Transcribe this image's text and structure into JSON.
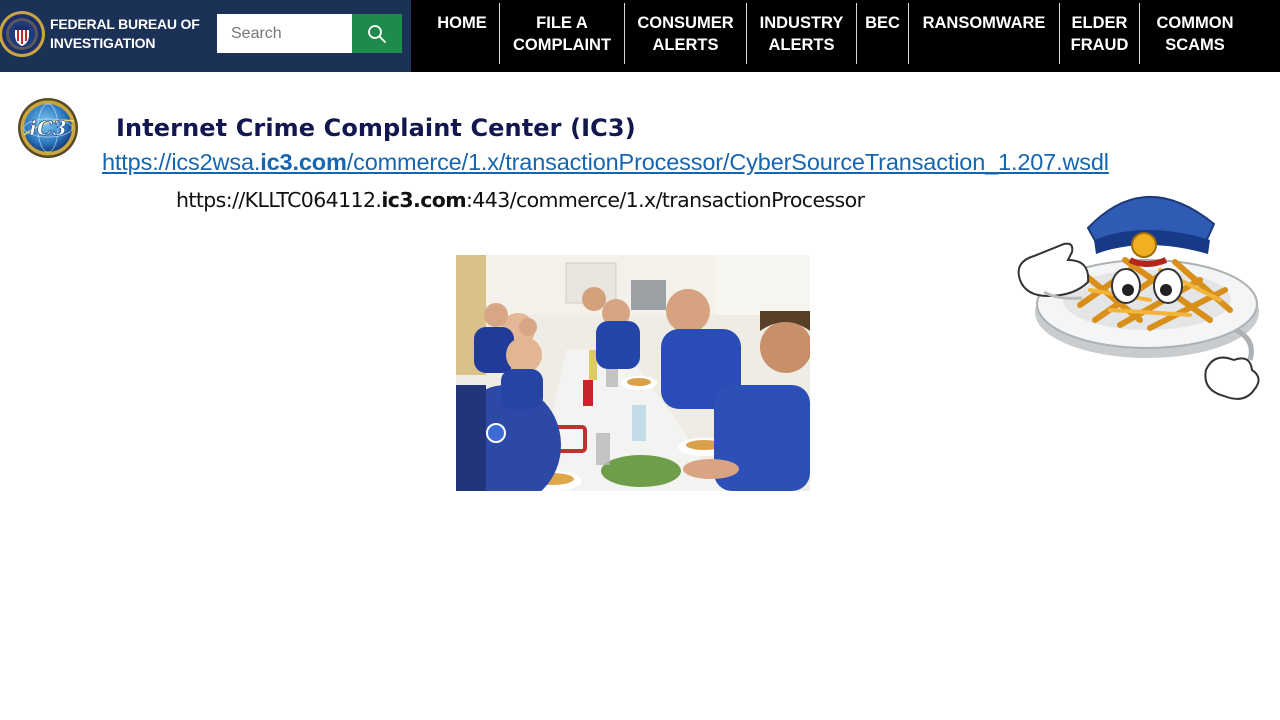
{
  "header": {
    "brand_name": "FEDERAL BUREAU OF\nINVESTIGATION",
    "search": {
      "placeholder": "Search",
      "value": ""
    },
    "colors": {
      "brand_bg": "#1c3156",
      "nav_bg": "#000000",
      "search_button": "#1e8a4c"
    },
    "nav_items": [
      {
        "label": "HOME"
      },
      {
        "label": "FILE A\nCOMPLAINT"
      },
      {
        "label": "CONSUMER\nALERTS"
      },
      {
        "label": "INDUSTRY\nALERTS"
      },
      {
        "label": "BEC"
      },
      {
        "label": "RANSOMWARE"
      },
      {
        "label": "ELDER\nFRAUD"
      },
      {
        "label": "COMMON\nSCAMS"
      }
    ]
  },
  "main": {
    "logo_icon": "ic3-globe-logo",
    "title": "Internet Crime Complaint Center (IC3)",
    "wsdl_link": {
      "prefix": "https://ics2wsa.",
      "domain": "ic3.com",
      "suffix": "/commerce/1.x/transactionProcessor/CyberSourceTransaction_1.207.wsdl"
    },
    "endpoint": {
      "prefix": "https://KLLTC064112.",
      "domain": "ic3.com",
      "suffix": ":443/commerce/1.x/transactionProcessor"
    },
    "photo_subject": "uniformed-officers-eating-pasta",
    "mascot_subject": "saluting-pasta-plate-police-cap"
  }
}
